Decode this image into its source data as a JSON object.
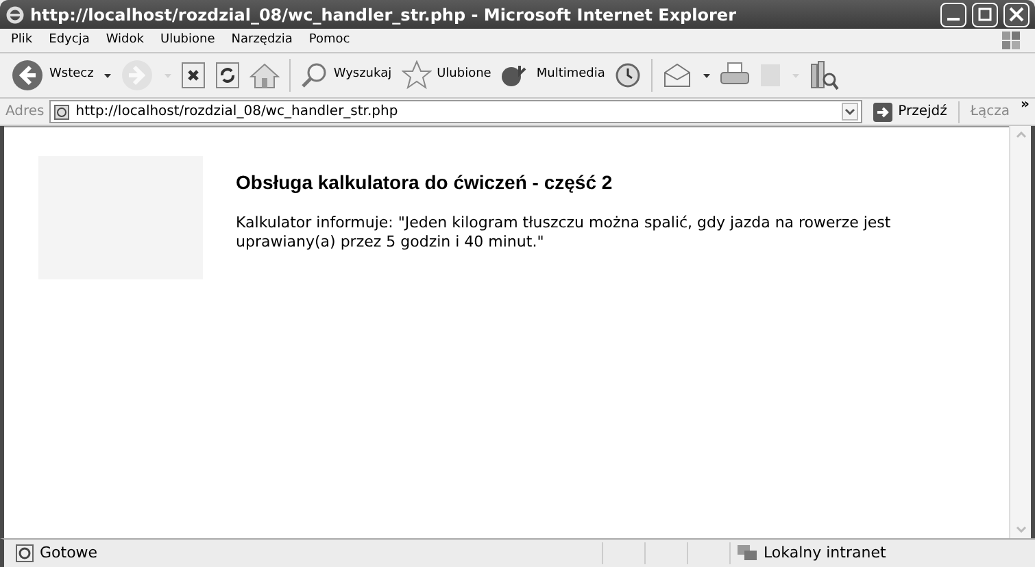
{
  "window": {
    "title": "http://localhost/rozdzial_08/wc_handler_str.php - Microsoft Internet Explorer"
  },
  "menu": [
    "Plik",
    "Edycja",
    "Widok",
    "Ulubione",
    "Narzędzia",
    "Pomoc"
  ],
  "toolbar": [
    {
      "kind": "back",
      "label": "Wstecz",
      "dropdown": true,
      "disabled": false
    },
    {
      "kind": "forward",
      "dropdown": true,
      "disabled": true
    },
    {
      "kind": "stop",
      "dropdown": false,
      "disabled": false
    },
    {
      "kind": "refresh",
      "dropdown": false,
      "disabled": false
    },
    {
      "kind": "home",
      "dropdown": false,
      "disabled": false
    },
    {
      "kind": "search",
      "label": "Wyszukaj",
      "dropdown": false,
      "disabled": false
    },
    {
      "kind": "favorites",
      "label": "Ulubione",
      "dropdown": false,
      "disabled": false
    },
    {
      "kind": "media",
      "label": "Multimedia",
      "dropdown": false,
      "disabled": false
    },
    {
      "kind": "history",
      "dropdown": false,
      "disabled": false
    },
    {
      "kind": "mail",
      "dropdown": true,
      "disabled": false
    },
    {
      "kind": "print",
      "dropdown": false,
      "disabled": false
    },
    {
      "kind": "edit",
      "dropdown": true,
      "disabled": true
    },
    {
      "kind": "research",
      "dropdown": false,
      "disabled": false
    }
  ],
  "address_bar": {
    "label": "Adres",
    "value": "http://localhost/rozdzial_08/wc_handler_str.php",
    "go": "Przejdź",
    "links": "Łącza",
    "more": "»"
  },
  "page": {
    "heading": "Obsługa kalkulatora do ćwiczeń - część 2",
    "text": "Kalkulator informuje: \"Jeden kilogram tłuszczu można spalić, gdy jazda na rowerze jest uprawiany(a) przez 5 godzin i 40 minut.\""
  },
  "status_bar": {
    "status": "Gotowe",
    "zone": "Lokalny intranet"
  }
}
